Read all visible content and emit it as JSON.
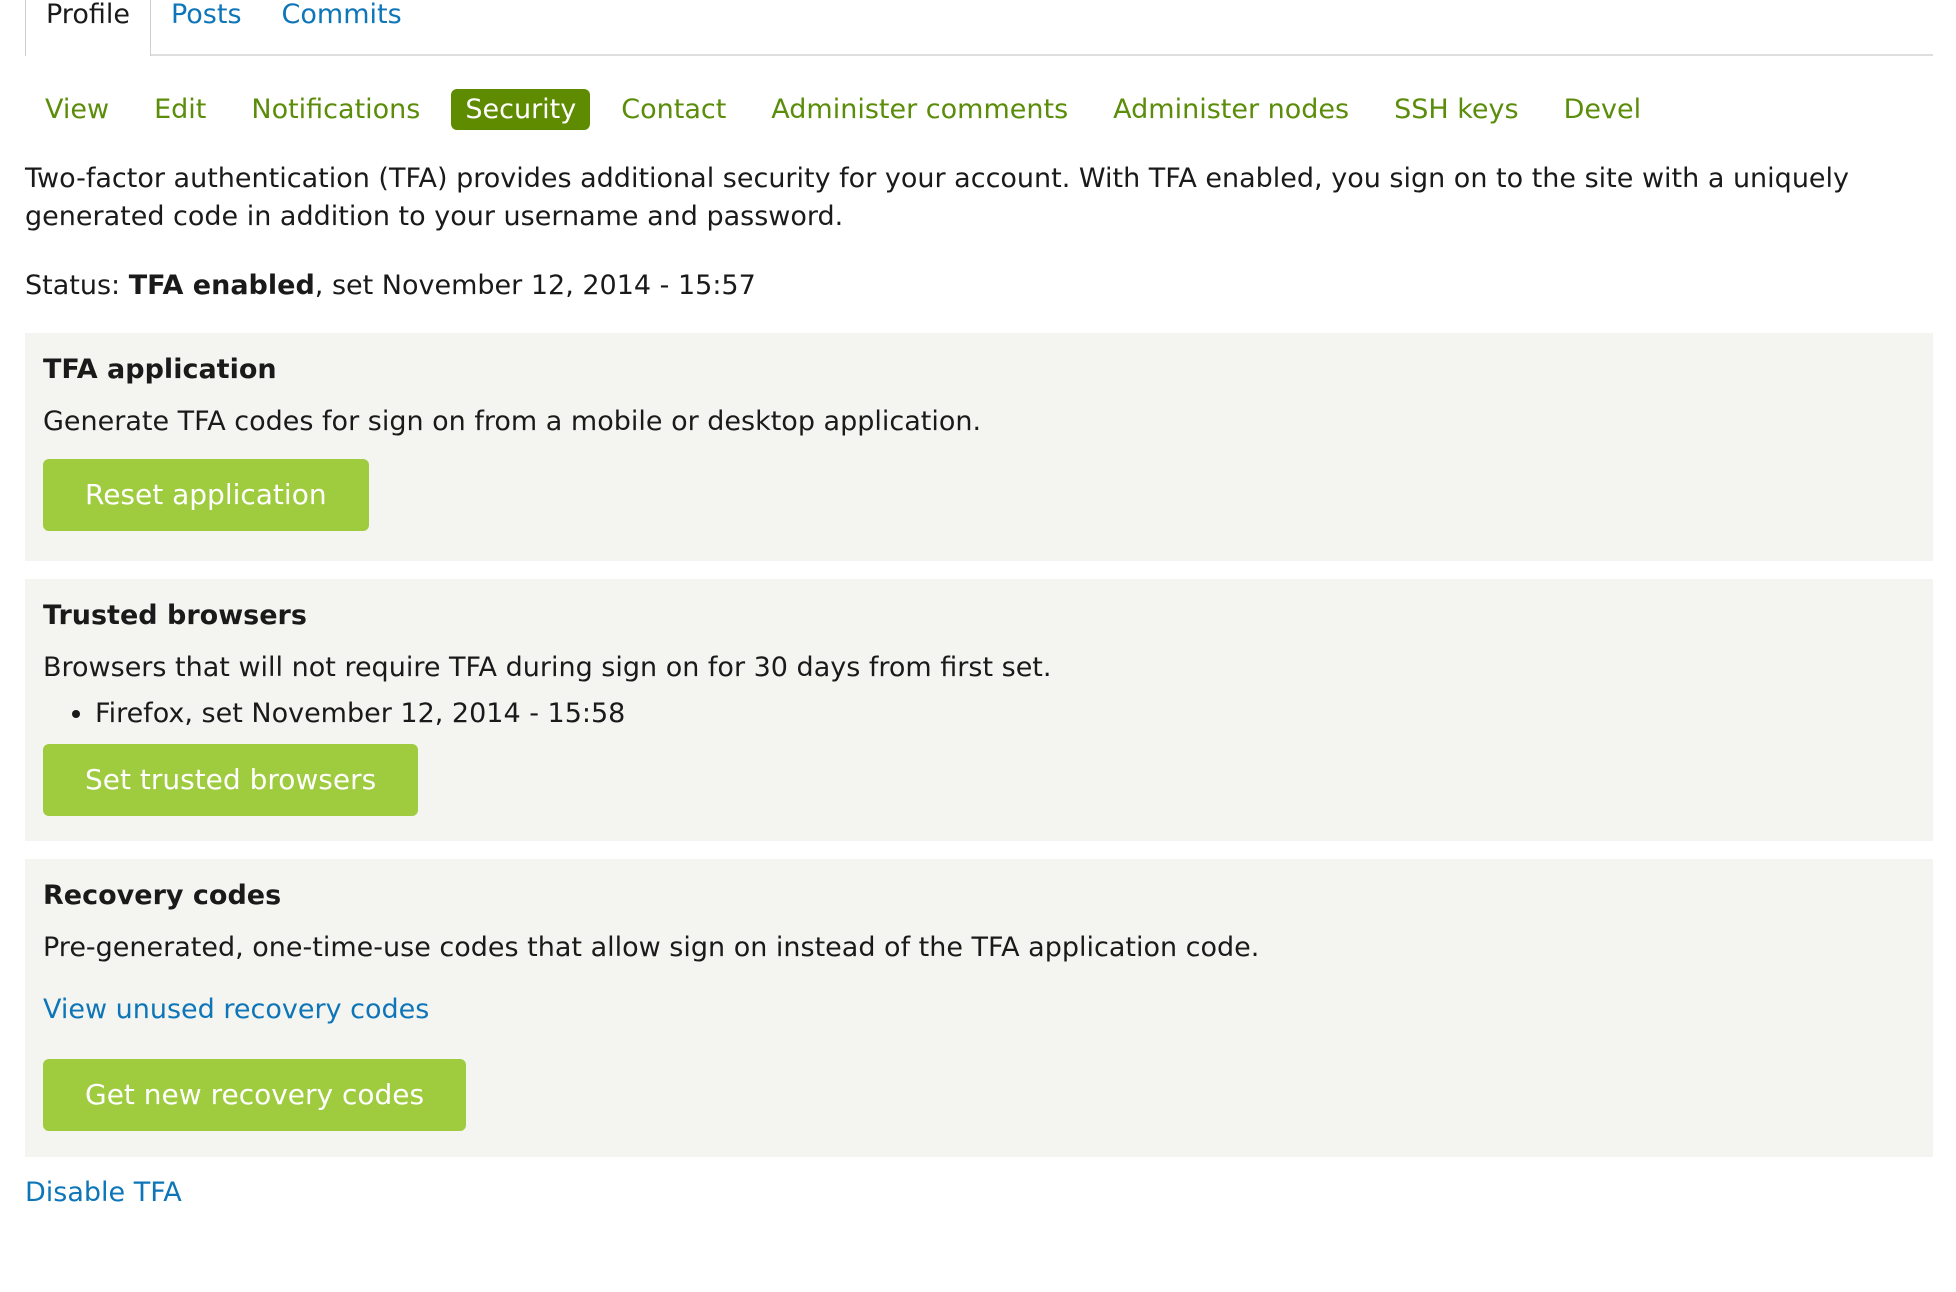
{
  "primary_tabs": [
    {
      "label": "Profile",
      "active": true
    },
    {
      "label": "Posts",
      "active": false
    },
    {
      "label": "Commits",
      "active": false
    }
  ],
  "secondary_tabs": [
    {
      "label": "View",
      "active": false
    },
    {
      "label": "Edit",
      "active": false
    },
    {
      "label": "Notifications",
      "active": false
    },
    {
      "label": "Security",
      "active": true
    },
    {
      "label": "Contact",
      "active": false
    },
    {
      "label": "Administer comments",
      "active": false
    },
    {
      "label": "Administer nodes",
      "active": false
    },
    {
      "label": "SSH keys",
      "active": false
    },
    {
      "label": "Devel",
      "active": false
    }
  ],
  "intro": "Two-factor authentication (TFA) provides additional security for your account. With TFA enabled, you sign on to the site with a uniquely generated code in addition to your username and password.",
  "status": {
    "label": "Status:",
    "value": "TFA enabled",
    "detail": ", set November 12, 2014 - 15:57"
  },
  "tfa_application": {
    "title": "TFA application",
    "description": "Generate TFA codes for sign on from a mobile or desktop application.",
    "button": "Reset application"
  },
  "trusted_browsers": {
    "title": "Trusted browsers",
    "description": "Browsers that will not require TFA during sign on for 30 days from first set.",
    "items": [
      "Firefox, set November 12, 2014 - 15:58"
    ],
    "button": "Set trusted browsers"
  },
  "recovery_codes": {
    "title": "Recovery codes",
    "description": "Pre-generated, one-time-use codes that allow sign on instead of the TFA application code.",
    "link": "View unused recovery codes",
    "button": "Get new recovery codes"
  },
  "disable_link": "Disable TFA",
  "colors": {
    "link": "#0e76b8",
    "tab_text": "#5b8d0a",
    "tab_active_bg": "#5f8b00",
    "button_bg": "#9fcb3e",
    "panel_bg": "#f4f4f1"
  }
}
